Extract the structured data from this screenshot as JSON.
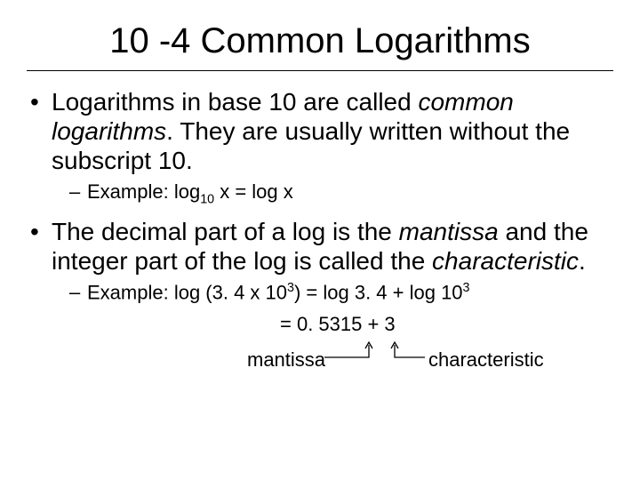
{
  "title": "10 -4 Common Logarithms",
  "bullets": {
    "b1": {
      "pre": "Logarithms in base 10 are called ",
      "em": "common logarithms",
      "post": ".  They are usually written without the subscript 10."
    },
    "b1ex": {
      "label": "Example: ",
      "lhs_a": "log",
      "lhs_sub": "10",
      "lhs_b": " x = log x"
    },
    "b2": {
      "pre": "The decimal part of a log is the ",
      "em1": "mantissa",
      "mid": " and the integer part of the log is called the ",
      "em2": "characteristic",
      "post": "."
    },
    "b2ex": {
      "label": "Example: ",
      "line1_a": "log (3. 4 x 10",
      "line1_sup1": "3",
      "line1_b": ") = log 3. 4 + log 10",
      "line1_sup2": "3",
      "line2": "= 0. 5315 + 3"
    }
  },
  "labels": {
    "mantissa": "mantissa",
    "characteristic": "characteristic"
  }
}
